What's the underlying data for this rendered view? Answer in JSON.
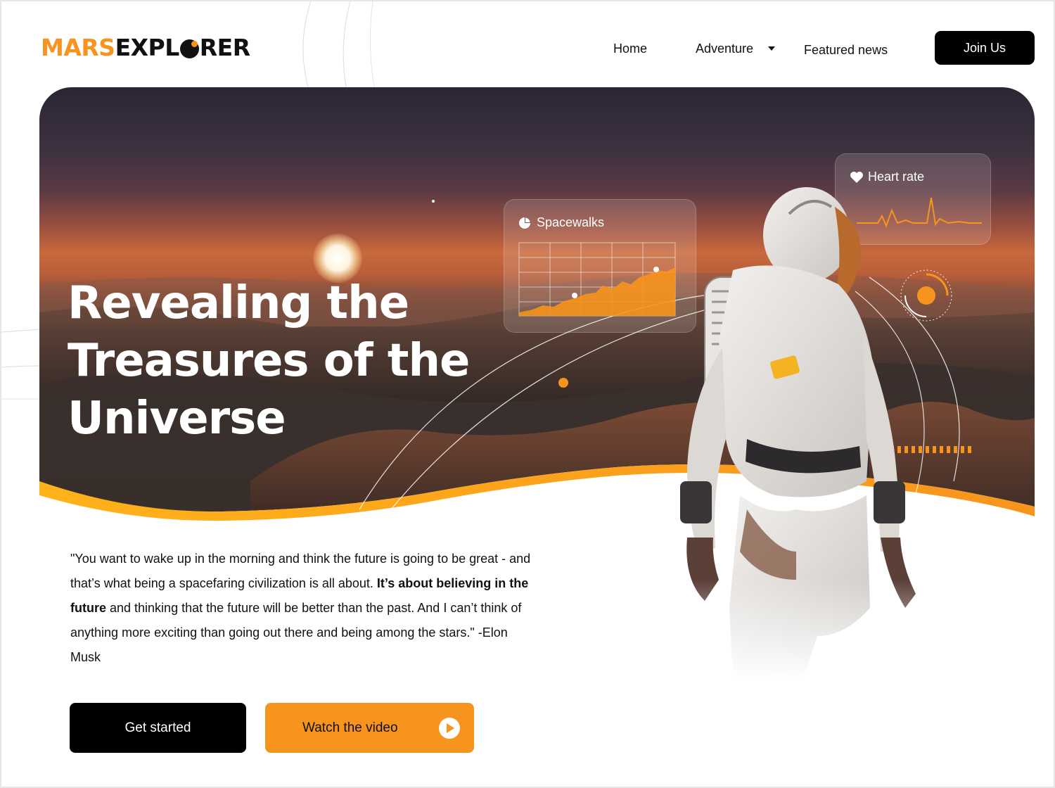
{
  "brand": {
    "logo_part1": "MARS",
    "logo_part2": "EXPL",
    "logo_part3": "RER"
  },
  "nav": {
    "home": "Home",
    "adventure": "Adventure",
    "featured": "Featured news",
    "join": "Join Us"
  },
  "hero": {
    "title_line1": "Revealing the",
    "title_line2": "Treasures of the",
    "title_line3": "Universe"
  },
  "widgets": {
    "spacewalks": "Spacewalks",
    "heart_rate": "Heart rate"
  },
  "quote": {
    "part1": "\"You want to wake up in the morning and think the future is going to be great - and that’s what being a spacefaring civilization is all about. ",
    "bold": "It’s about believing in the future",
    "part2": " and thinking that the future will be better than the past. And I can’t think of anything more exciting than going out there and being among the stars.\" -Elon Musk"
  },
  "buttons": {
    "get_started": "Get started",
    "watch_video": "Watch the video"
  },
  "colors": {
    "accent": "#f7941d",
    "dark": "#000000"
  },
  "icons": [
    "heart-icon",
    "pie-chart-icon",
    "play-icon",
    "chevron-down-icon"
  ]
}
